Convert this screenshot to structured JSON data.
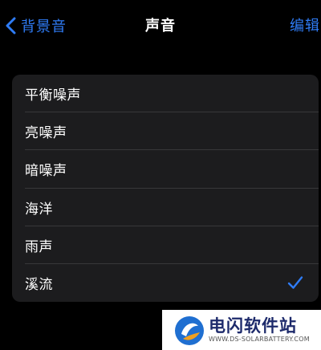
{
  "navbar": {
    "back_label": "背景音",
    "title": "声音",
    "edit_label": "编辑"
  },
  "sounds": {
    "items": [
      {
        "label": "平衡噪声",
        "selected": false
      },
      {
        "label": "亮噪声",
        "selected": false
      },
      {
        "label": "暗噪声",
        "selected": false
      },
      {
        "label": "海洋",
        "selected": false
      },
      {
        "label": "雨声",
        "selected": false
      },
      {
        "label": "溪流",
        "selected": true
      }
    ]
  },
  "watermark": {
    "name": "电闪软件站",
    "url": "WWW.DS-SOLARBATTERY.COM"
  },
  "colors": {
    "accent": "#2f7cf6",
    "background": "#000000",
    "card": "#1c1c1e",
    "divider": "#38383a"
  }
}
